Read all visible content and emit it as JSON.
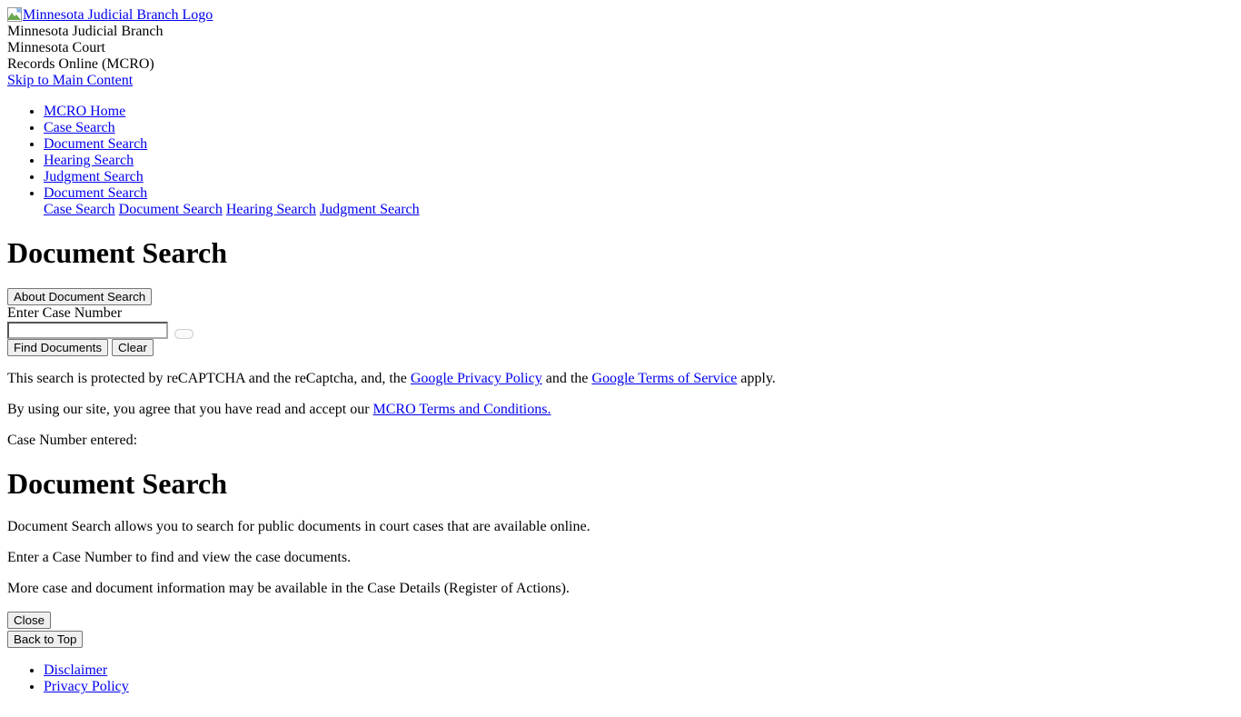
{
  "header": {
    "logo_alt": "Minnesota Judicial Branch Logo",
    "logo_icon": "broken-image-icon",
    "org_name": "Minnesota Judicial Branch",
    "site_name_line1": "Minnesota Court",
    "site_name_line2": "Records Online (MCRO)",
    "skip_link": "Skip to Main Content"
  },
  "nav": {
    "items": [
      {
        "label": "MCRO Home"
      },
      {
        "label": "Case Search"
      },
      {
        "label": "Document Search"
      },
      {
        "label": "Hearing Search"
      },
      {
        "label": "Judgment Search"
      },
      {
        "label": "Document Search"
      }
    ],
    "sub_links": [
      {
        "label": "Case Search"
      },
      {
        "label": "Document Search"
      },
      {
        "label": "Hearing Search"
      },
      {
        "label": "Judgment Search"
      }
    ]
  },
  "main": {
    "page_title": "Document Search",
    "about_button": "About Document Search",
    "case_number_label": "Enter Case Number",
    "case_number_value": "",
    "case_number_placeholder": "",
    "find_button": "Find Documents",
    "clear_button": "Clear",
    "recaptcha_notice_pre": "This search is protected by reCAPTCHA and the reCaptcha, and, the ",
    "recaptcha_privacy_link": "Google Privacy Policy",
    "recaptcha_notice_mid": " and the ",
    "recaptcha_terms_link": "Google Terms of Service",
    "recaptcha_notice_post": " apply.",
    "terms_notice_pre": "By using our site, you agree that you have read and accept our ",
    "terms_link": "MCRO Terms and Conditions.",
    "case_number_entered_label": "Case Number entered:",
    "case_number_entered_value": ""
  },
  "about_panel": {
    "title": "Document Search",
    "paragraph1": "Document Search allows you to search for public documents in court cases that are available online.",
    "paragraph2": "Enter a Case Number to find and view the case documents.",
    "paragraph3": "More case and document information may be available in the Case Details (Register of Actions).",
    "close_button": "Close",
    "back_to_top_button": "Back to Top"
  },
  "footer": {
    "items": [
      {
        "label": "Disclaimer"
      },
      {
        "label": "Privacy Policy"
      }
    ]
  },
  "colors": {
    "link": "#0000EE",
    "text": "#000000",
    "background": "#FFFFFF",
    "button_face": "#EFEFEF",
    "button_border": "#767676"
  }
}
